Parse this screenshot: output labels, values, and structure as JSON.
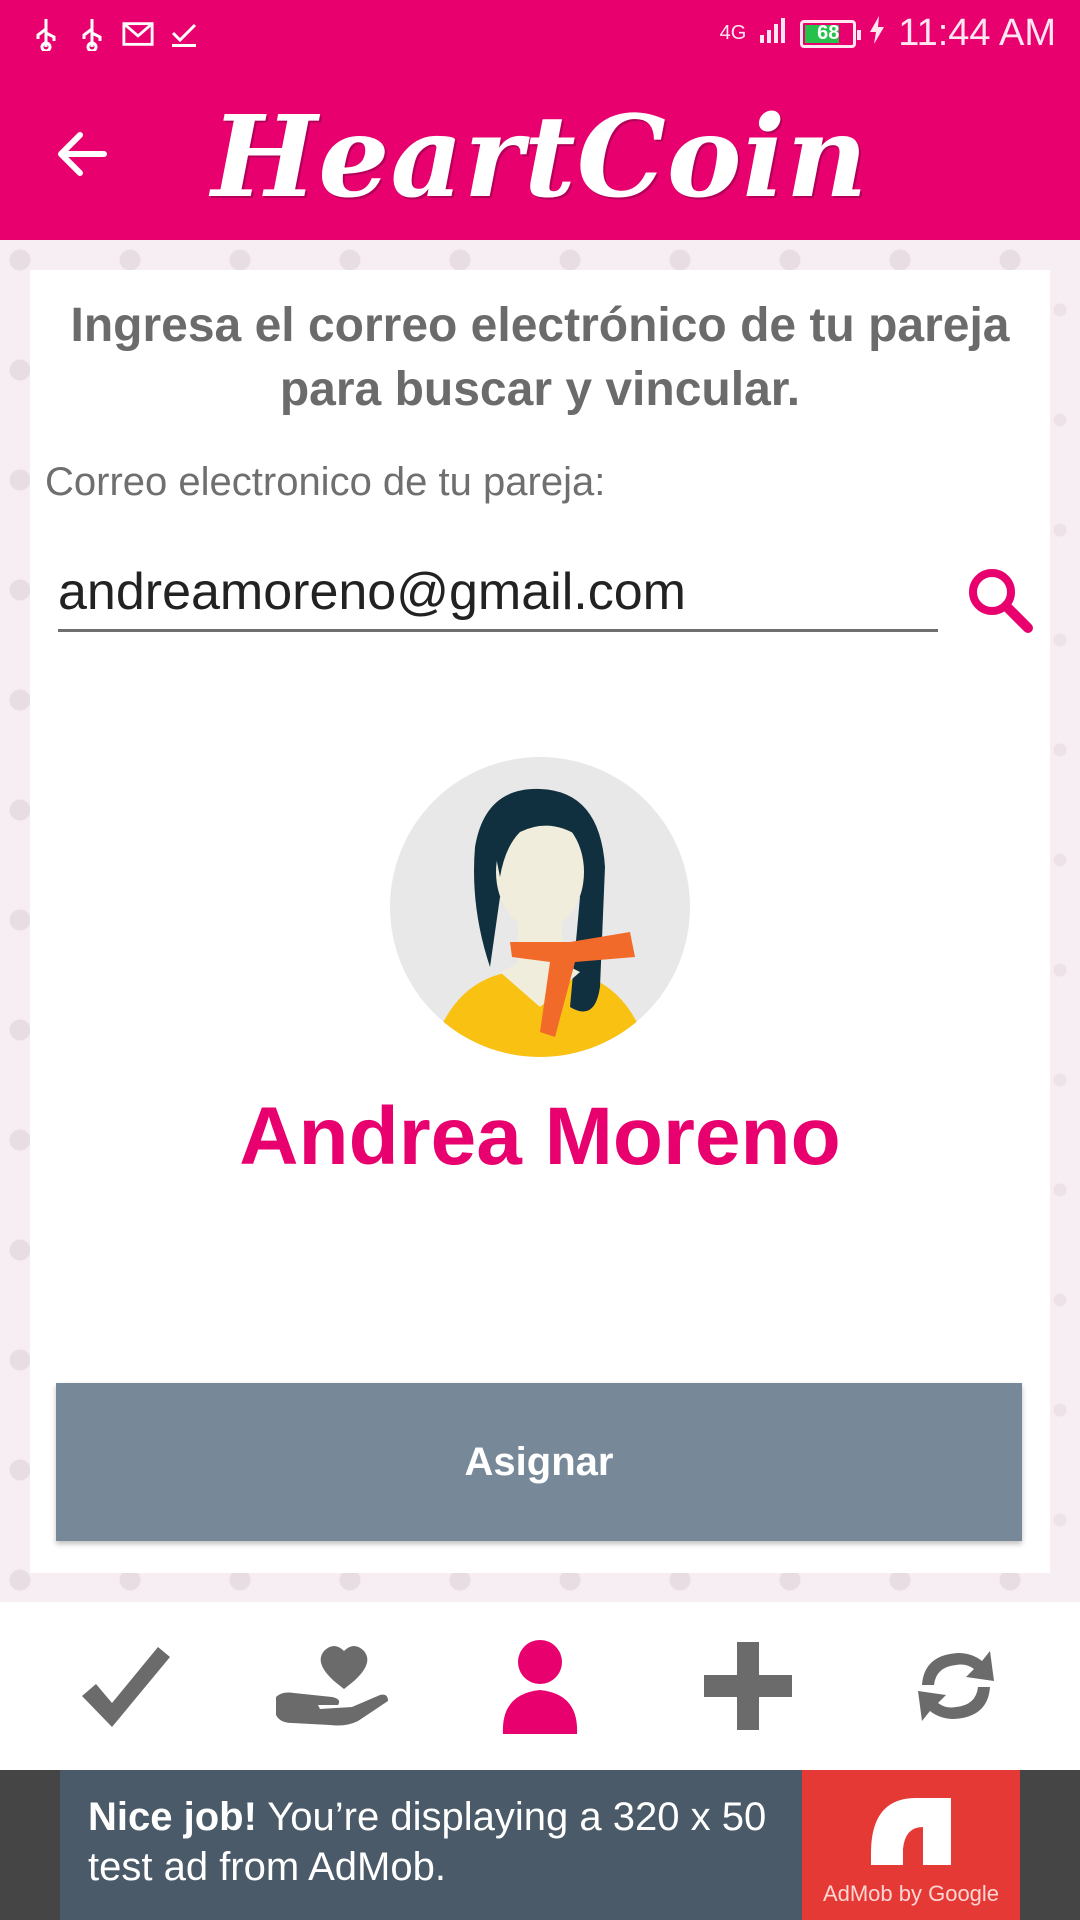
{
  "status_bar": {
    "network": "4G",
    "battery": "68",
    "time": "11:44 AM"
  },
  "app_bar": {
    "title": "HeartCoin"
  },
  "form": {
    "heading": "Ingresa el correo electrónico de tu pareja para buscar y vincular.",
    "email_label": "Correo electronico de tu pareja:",
    "email_value": "andreamoreno@gmail.com"
  },
  "partner": {
    "name": "Andrea Moreno"
  },
  "actions": {
    "assign_label": "Asignar"
  },
  "bottom_nav": {
    "items": [
      {
        "icon": "check-icon",
        "active": false
      },
      {
        "icon": "heart-hand-icon",
        "active": false
      },
      {
        "icon": "person-icon",
        "active": true
      },
      {
        "icon": "plus-icon",
        "active": false
      },
      {
        "icon": "refresh-icon",
        "active": false
      }
    ]
  },
  "ad": {
    "bold": "Nice job!",
    "text": " You’re displaying a 320 x 50 test ad from AdMob.",
    "brand": "AdMob by Google"
  },
  "colors": {
    "primary": "#e8006f",
    "button": "#778899",
    "inactive_icon": "#6b6b6b"
  }
}
